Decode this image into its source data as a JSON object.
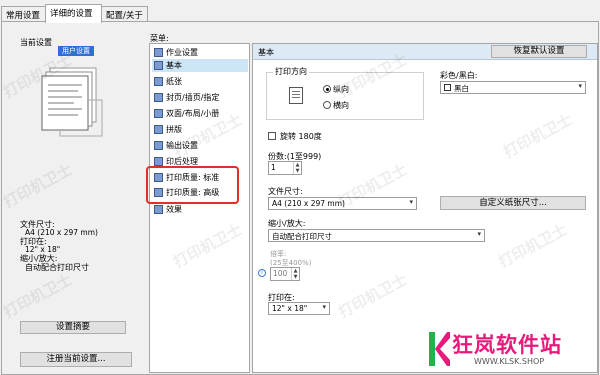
{
  "tabs": [
    "常用设置",
    "详细的设置",
    "配置/关于"
  ],
  "left_panel": {
    "current_settings_label": "当前设置",
    "preview_caption": "用户设置",
    "summary": [
      {
        "label": "文件尺寸:",
        "value": "A4 (210 x 297 mm)"
      },
      {
        "label": "打印在:",
        "value": "12\" x 18\""
      },
      {
        "label": "缩小/放大:",
        "value": "自动配合打印尺寸"
      }
    ],
    "settings_summary_button": "设置摘要",
    "register_button": "注册当前设置..."
  },
  "menu": {
    "title": "菜单:",
    "items": [
      "作业设置",
      "基本",
      "纸张",
      "封页/插页/指定",
      "双面/布局/小册",
      "拼版",
      "输出设置",
      "印后处理",
      "打印质量: 标准",
      "打印质量: 高级",
      "效果"
    ],
    "selected_index": 1
  },
  "content": {
    "header_title": "基本",
    "restore_button": "恢复默认设置",
    "orientation": {
      "title": "打印方向",
      "options": [
        "纵向",
        "横向"
      ],
      "selected_index": 0
    },
    "color": {
      "label": "彩色/黑白:",
      "value": "黑白"
    },
    "rotate_label": "旋转 180度",
    "copies": {
      "label": "份数:(1至999)",
      "value": "1"
    },
    "paper_size": {
      "label": "文件尺寸:",
      "value": "A4 (210 x 297 mm)"
    },
    "custom_size_button": "自定义纸张尺寸...",
    "zoom": {
      "label": "缩小/放大:",
      "value": "自动配合打印尺寸"
    },
    "ratio": {
      "label": "倍率:",
      "range": "(25至400%)",
      "value": "100"
    },
    "print_on": {
      "label": "打印在:",
      "value": "12\" x 18\""
    }
  },
  "watermark_text": "打印机卫士",
  "branding": {
    "logo_text": "狂岚软件站",
    "url": "WWW.KLSK.SHOP"
  },
  "colors": {
    "highlight": "#e0302a",
    "menu_selected": "#cde6f7",
    "header_bg": "#dde9f5",
    "brand_pink": "#e9197b"
  }
}
